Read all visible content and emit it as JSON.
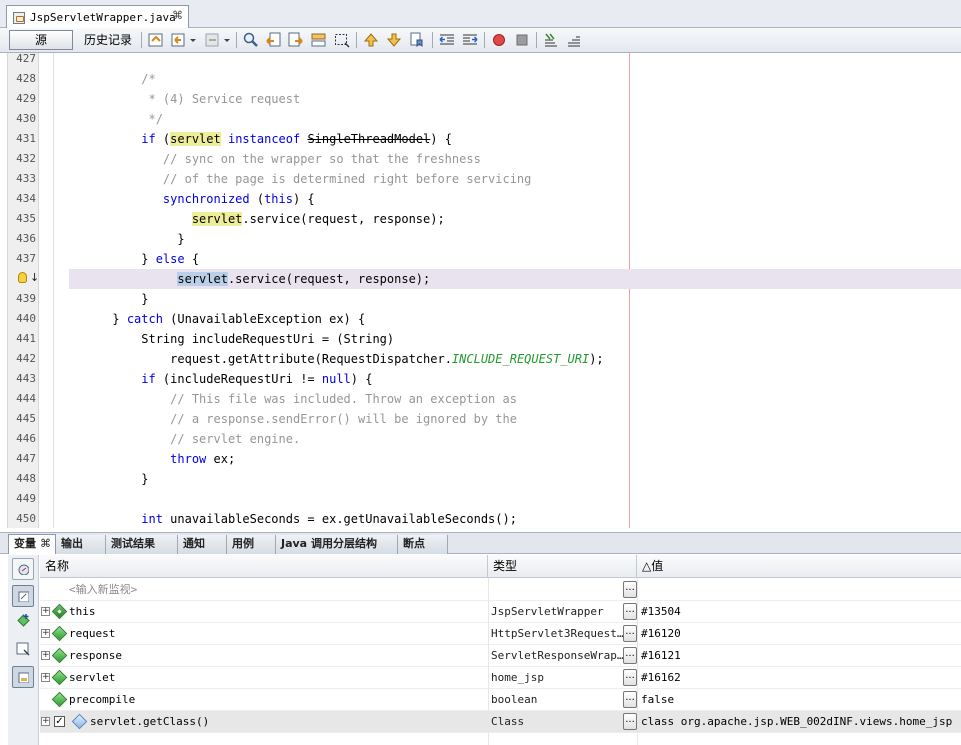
{
  "file_tab": {
    "title": "JspServletWrapper.java",
    "close": "⌘"
  },
  "toolbar": {
    "source_label": "源",
    "history_label": "历史记录"
  },
  "editor": {
    "lines": [
      {
        "num": "427"
      },
      {
        "num": "428"
      },
      {
        "num": "429"
      },
      {
        "num": "430"
      },
      {
        "num": "431"
      },
      {
        "num": "432"
      },
      {
        "num": "433"
      },
      {
        "num": "434"
      },
      {
        "num": "435"
      },
      {
        "num": "436"
      },
      {
        "num": "437"
      },
      {
        "num": ""
      },
      {
        "num": "439"
      },
      {
        "num": "440"
      },
      {
        "num": "441"
      },
      {
        "num": "442"
      },
      {
        "num": "443"
      },
      {
        "num": "444"
      },
      {
        "num": "445"
      },
      {
        "num": "446"
      },
      {
        "num": "447"
      },
      {
        "num": "448"
      },
      {
        "num": "449"
      },
      {
        "num": "450"
      }
    ],
    "code": {
      "l428": "/*",
      "l429": " * (4) Service request",
      "l430": " */",
      "l431_if": "if",
      "l431_servlet": "servlet",
      "l431_instanceof": "instanceof",
      "l431_type": "SingleThreadModel",
      "l431_end": ") {",
      "l432": "// sync on the wrapper so that the freshness",
      "l433": "// of the page is determined right before servicing",
      "l434_sync": "synchronized",
      "l434_this": "this",
      "l435_servlet": "servlet",
      "l435_rest": ".service(request, response);",
      "l436": "}",
      "l437_close": "} ",
      "l437_else": "else",
      "l437_brace": " {",
      "l438_servlet": "servlet",
      "l438_rest": ".service(request, response);",
      "l439": "}",
      "l440_close": "} ",
      "l440_catch": "catch",
      "l440_rest": " (UnavailableException ex) {",
      "l441": "String includeRequestUri = (String)",
      "l442_pre": "request.getAttribute(RequestDispatcher.",
      "l442_const": "INCLUDE_REQUEST_URI",
      "l442_post": ");",
      "l443_if": "if",
      "l443_mid": " (includeRequestUri != ",
      "l443_null": "null",
      "l443_end": ") {",
      "l444": "// This file was included. Throw an exception as",
      "l445": "// a response.sendError() will be ignored by the",
      "l446": "// servlet engine.",
      "l447_throw": "throw",
      "l447_rest": " ex;",
      "l448": "}",
      "l450_int": "int",
      "l450_rest": " unavailableSeconds = ex.getUnavailableSeconds();"
    }
  },
  "bottom_tabs": [
    {
      "label": "变量",
      "close": "⌘"
    },
    {
      "label": "输出"
    },
    {
      "label": "测试结果"
    },
    {
      "label": "通知"
    },
    {
      "label": "用例"
    },
    {
      "label": "Java 调用分层结构"
    },
    {
      "label": "断点"
    }
  ],
  "variables": {
    "headers": {
      "name": "名称",
      "type": "类型",
      "value": "值",
      "sort_indicator": "△"
    },
    "new_watch_placeholder": "<输入新监视>",
    "dots_label": "...",
    "rows": [
      {
        "name": "this",
        "type": "JspServletWrapper",
        "value": "#13504"
      },
      {
        "name": "request",
        "type": "HttpServlet3Request…",
        "value": "#16120"
      },
      {
        "name": "response",
        "type": "ServletResponseWrap…",
        "value": "#16121"
      },
      {
        "name": "servlet",
        "type": "home_jsp",
        "value": "#16162"
      },
      {
        "name": "precompile",
        "type": "boolean",
        "value": "false"
      },
      {
        "name": "servlet.getClass()",
        "type": "Class",
        "value": "class org.apache.jsp.WEB_002dINF.views.home_jsp"
      }
    ]
  }
}
